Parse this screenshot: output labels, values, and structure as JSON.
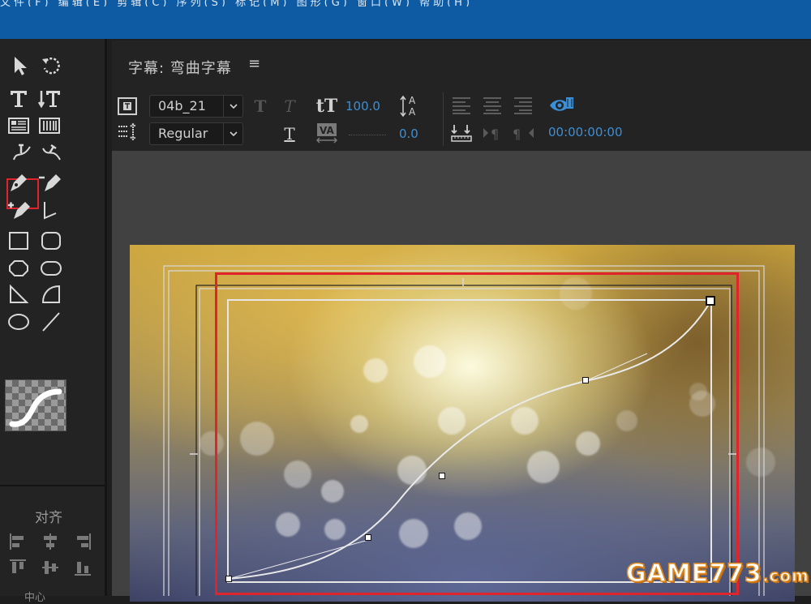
{
  "window": {
    "menu_partial": "文件(F)   编辑(E)   剪辑(C)   序列(S)   标记(M)   图形(G)   窗口(W)   帮助(H)"
  },
  "tools_panel": {
    "tools": [
      {
        "name": "selection-tool-icon"
      },
      {
        "name": "rotation-tool-icon"
      },
      {
        "name": "type-tool-icon"
      },
      {
        "name": "vertical-type-tool-icon"
      },
      {
        "name": "area-type-tool-icon"
      },
      {
        "name": "vertical-area-type-tool-icon"
      },
      {
        "name": "path-type-tool-icon"
      },
      {
        "name": "vertical-path-type-tool-icon"
      },
      {
        "name": "pen-tool-icon"
      },
      {
        "name": "delete-anchor-tool-icon"
      },
      {
        "name": "add-anchor-tool-icon"
      },
      {
        "name": "convert-anchor-tool-icon"
      },
      {
        "name": "rectangle-tool-icon"
      },
      {
        "name": "rounded-rect-tool-icon"
      },
      {
        "name": "clipped-corner-rect-tool-icon"
      },
      {
        "name": "rounded-corner-rect-tool-icon"
      },
      {
        "name": "wedge-tool-icon"
      },
      {
        "name": "arc-tool-icon"
      },
      {
        "name": "ellipse-tool-icon"
      },
      {
        "name": "line-tool-icon"
      }
    ],
    "selected_tool": "path-type-tool-icon"
  },
  "align_panel": {
    "label": "对齐",
    "footer_label": "中心"
  },
  "title_panel": {
    "title": "字幕: 弯曲字幕",
    "menu_icon": "≡",
    "font_family": "04b_21",
    "font_style": "Regular",
    "font_size": "100.0",
    "kerning": "0.0",
    "timecode": "00:00:00:00",
    "bold_glyph": "T",
    "italic_glyph": "T",
    "underline_glyph": "T",
    "size_glyph": "tT"
  },
  "watermark": {
    "text": "GAME773",
    "suffix": ".com"
  },
  "colors": {
    "accent_blue": "#3b8fd6",
    "title_bar": "#0e5aa3",
    "selection_red": "#e0242b"
  }
}
